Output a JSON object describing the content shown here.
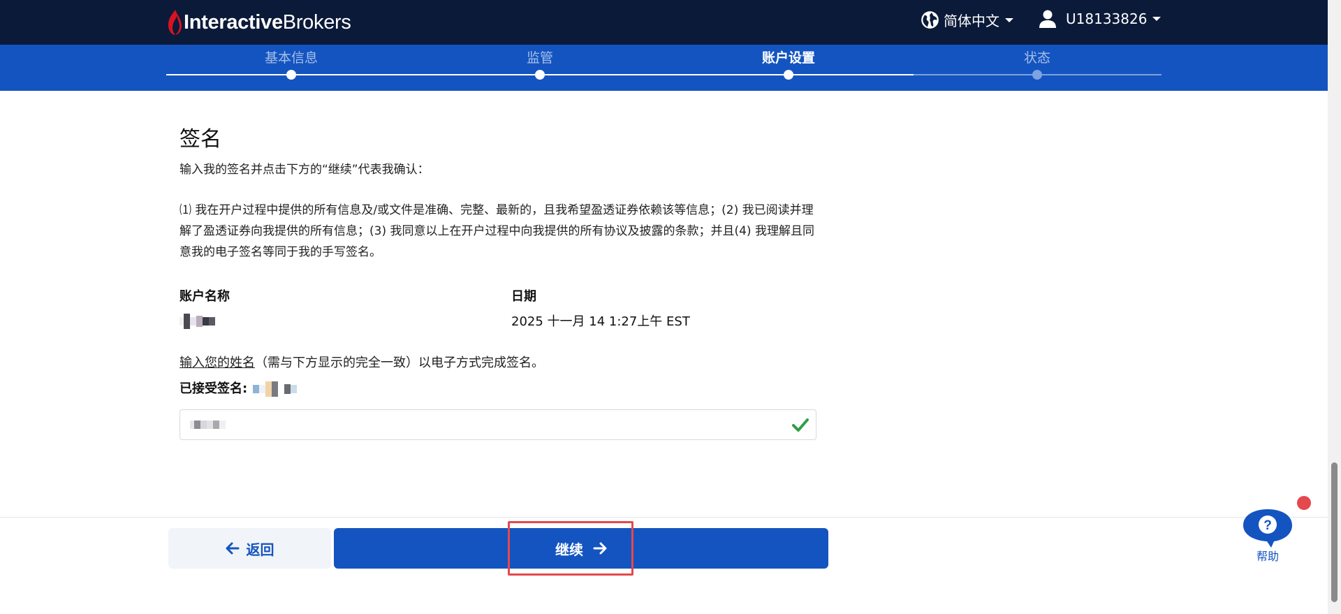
{
  "header": {
    "logo_bold": "Interactive",
    "logo_regular": "Brokers",
    "language": "简体中文",
    "user_id": "U18133826",
    "icons": {
      "language": "globe-icon",
      "user": "user-icon"
    }
  },
  "stepper": {
    "steps": [
      {
        "label": "基本信息",
        "state": "complete"
      },
      {
        "label": "监管",
        "state": "complete"
      },
      {
        "label": "账户设置",
        "state": "current"
      },
      {
        "label": "状态",
        "state": "pending"
      }
    ]
  },
  "signature": {
    "title": "签名",
    "intro": "输入我的签名并点击下方的“继续”代表我确认：",
    "terms": "⑴ 我在开户过程中提供的所有信息及/或文件是准确、完整、最新的，且我希望盈透证券依赖该等信息；(2) 我已阅读并理解了盈透证券向我提供的所有信息；(3) 我同意以上在开户过程中向我提供的所有协议及披露的条款；并且(4) 我理解且同意我的电子签名等同于我的手写签名。",
    "account_name_label": "账户名称",
    "date_label": "日期",
    "date_value": "2025 十一月 14 1:27上午 EST",
    "name_instruction_link": "输入您的姓名",
    "name_instruction_rest": "（需与下方显示的完全一致）以电子方式完成签名。",
    "accepted_label": "已接受签名:"
  },
  "footer": {
    "back_label": "返回",
    "continue_label": "继续"
  },
  "help": {
    "label": "帮助",
    "icon": "help-bubble-icon"
  },
  "colors": {
    "nav_bg": "#0b1a38",
    "brand_blue": "#1454c0",
    "brand_red": "#d81222",
    "success_green": "#2e9e45",
    "highlight_red": "#e5484d"
  }
}
